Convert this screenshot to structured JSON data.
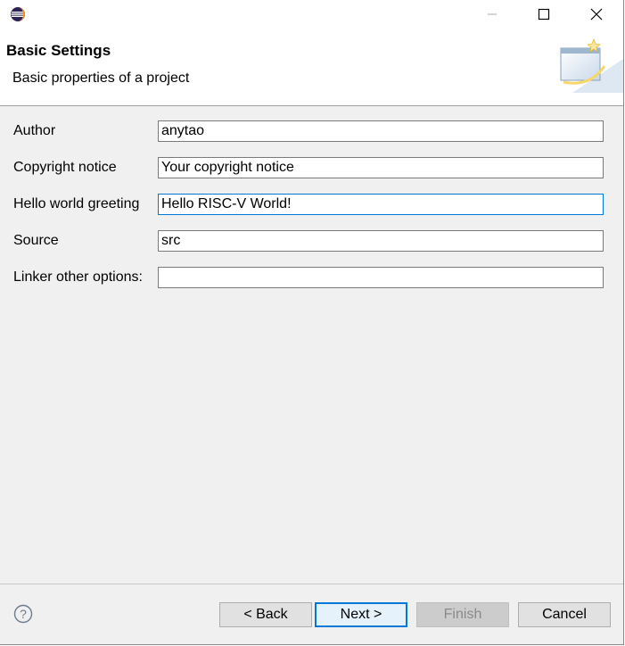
{
  "titlebar": {
    "app_icon": "eclipse-icon",
    "minimize_icon": "minimize-icon",
    "maximize_icon": "maximize-icon",
    "close_icon": "close-icon"
  },
  "header": {
    "title": "Basic Settings",
    "description": "Basic properties of a project",
    "graphic_icon": "wizard-banner-icon"
  },
  "form": {
    "fields": [
      {
        "label": "Author",
        "value": "anytao"
      },
      {
        "label": "Copyright notice",
        "value": "Your copyright notice"
      },
      {
        "label": "Hello world greeting",
        "value": "Hello RISC-V World!"
      },
      {
        "label": "Source",
        "value": "src"
      },
      {
        "label": "Linker other options:",
        "value": ""
      }
    ]
  },
  "footer": {
    "help_icon": "help-icon",
    "back_label": "< Back",
    "next_label": "Next >",
    "finish_label": "Finish",
    "cancel_label": "Cancel"
  },
  "colors": {
    "accent": "#0078d7",
    "dialog_bg": "#f0f0f0",
    "header_bg": "#ffffff"
  }
}
